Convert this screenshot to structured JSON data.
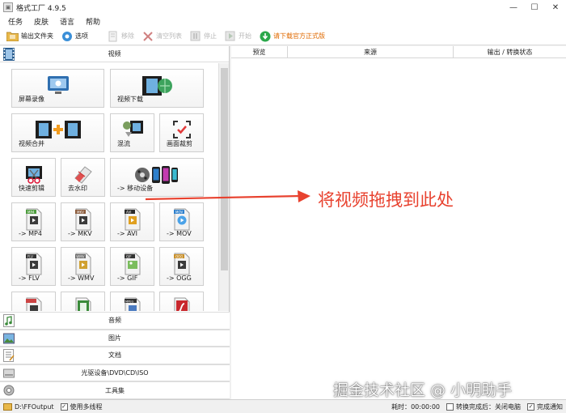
{
  "window": {
    "title": "格式工厂 4.9.5"
  },
  "menu": [
    "任务",
    "皮肤",
    "语言",
    "帮助"
  ],
  "toolbar": {
    "output_folder": "输出文件夹",
    "options": "选项",
    "remove": "移除",
    "clear_list": "清空列表",
    "stop": "停止",
    "start": "开始",
    "download_promo": "请下载官方正式版"
  },
  "left": {
    "video_category": "视频",
    "tiles": {
      "screen_record": "屏幕录像",
      "video_download": "视频下载",
      "video_merge": "视频合并",
      "mux": "混流",
      "crop": "画面裁剪",
      "fast_cut": "快速剪辑",
      "remove_watermark": "去水印",
      "to_mobile": "-> 移动设备",
      "to_mp4": "-> MP4",
      "to_mkv": "-> MKV",
      "to_avi": "-> AVI",
      "to_mov": "-> MOV",
      "to_flv": "-> FLV",
      "to_wmv": "-> WMV",
      "to_gif": "-> GIF",
      "to_ogg": "-> OGG"
    },
    "icon_tags": {
      "mp4": "MP4",
      "mkv": "MKV",
      "avi": "AVI",
      "mov": "MOV",
      "flv": "FLV",
      "wmv": "WMV",
      "gif": "GIF",
      "ogg": "OGG",
      "mpeg": "MPEG"
    },
    "categories": {
      "audio": "音频",
      "picture": "图片",
      "document": "文档",
      "rom_device": "光驱设备\\DVD\\CD\\ISO",
      "toolset": "工具集"
    }
  },
  "right": {
    "columns": [
      "预览",
      "来源",
      "输出 / 转换状态"
    ]
  },
  "annotation": {
    "text": "将视频拖拽到此处",
    "color": "#e8422f"
  },
  "watermark": "掘金技术社区 @ 小明助手",
  "status": {
    "output_path": "D:\\FFOutput",
    "multithread": "使用多线程",
    "elapsed_label": "耗时：",
    "elapsed_value": "00:00:00",
    "after_convert": "转换完成后：关闭电脑",
    "notify": "完成通知"
  }
}
